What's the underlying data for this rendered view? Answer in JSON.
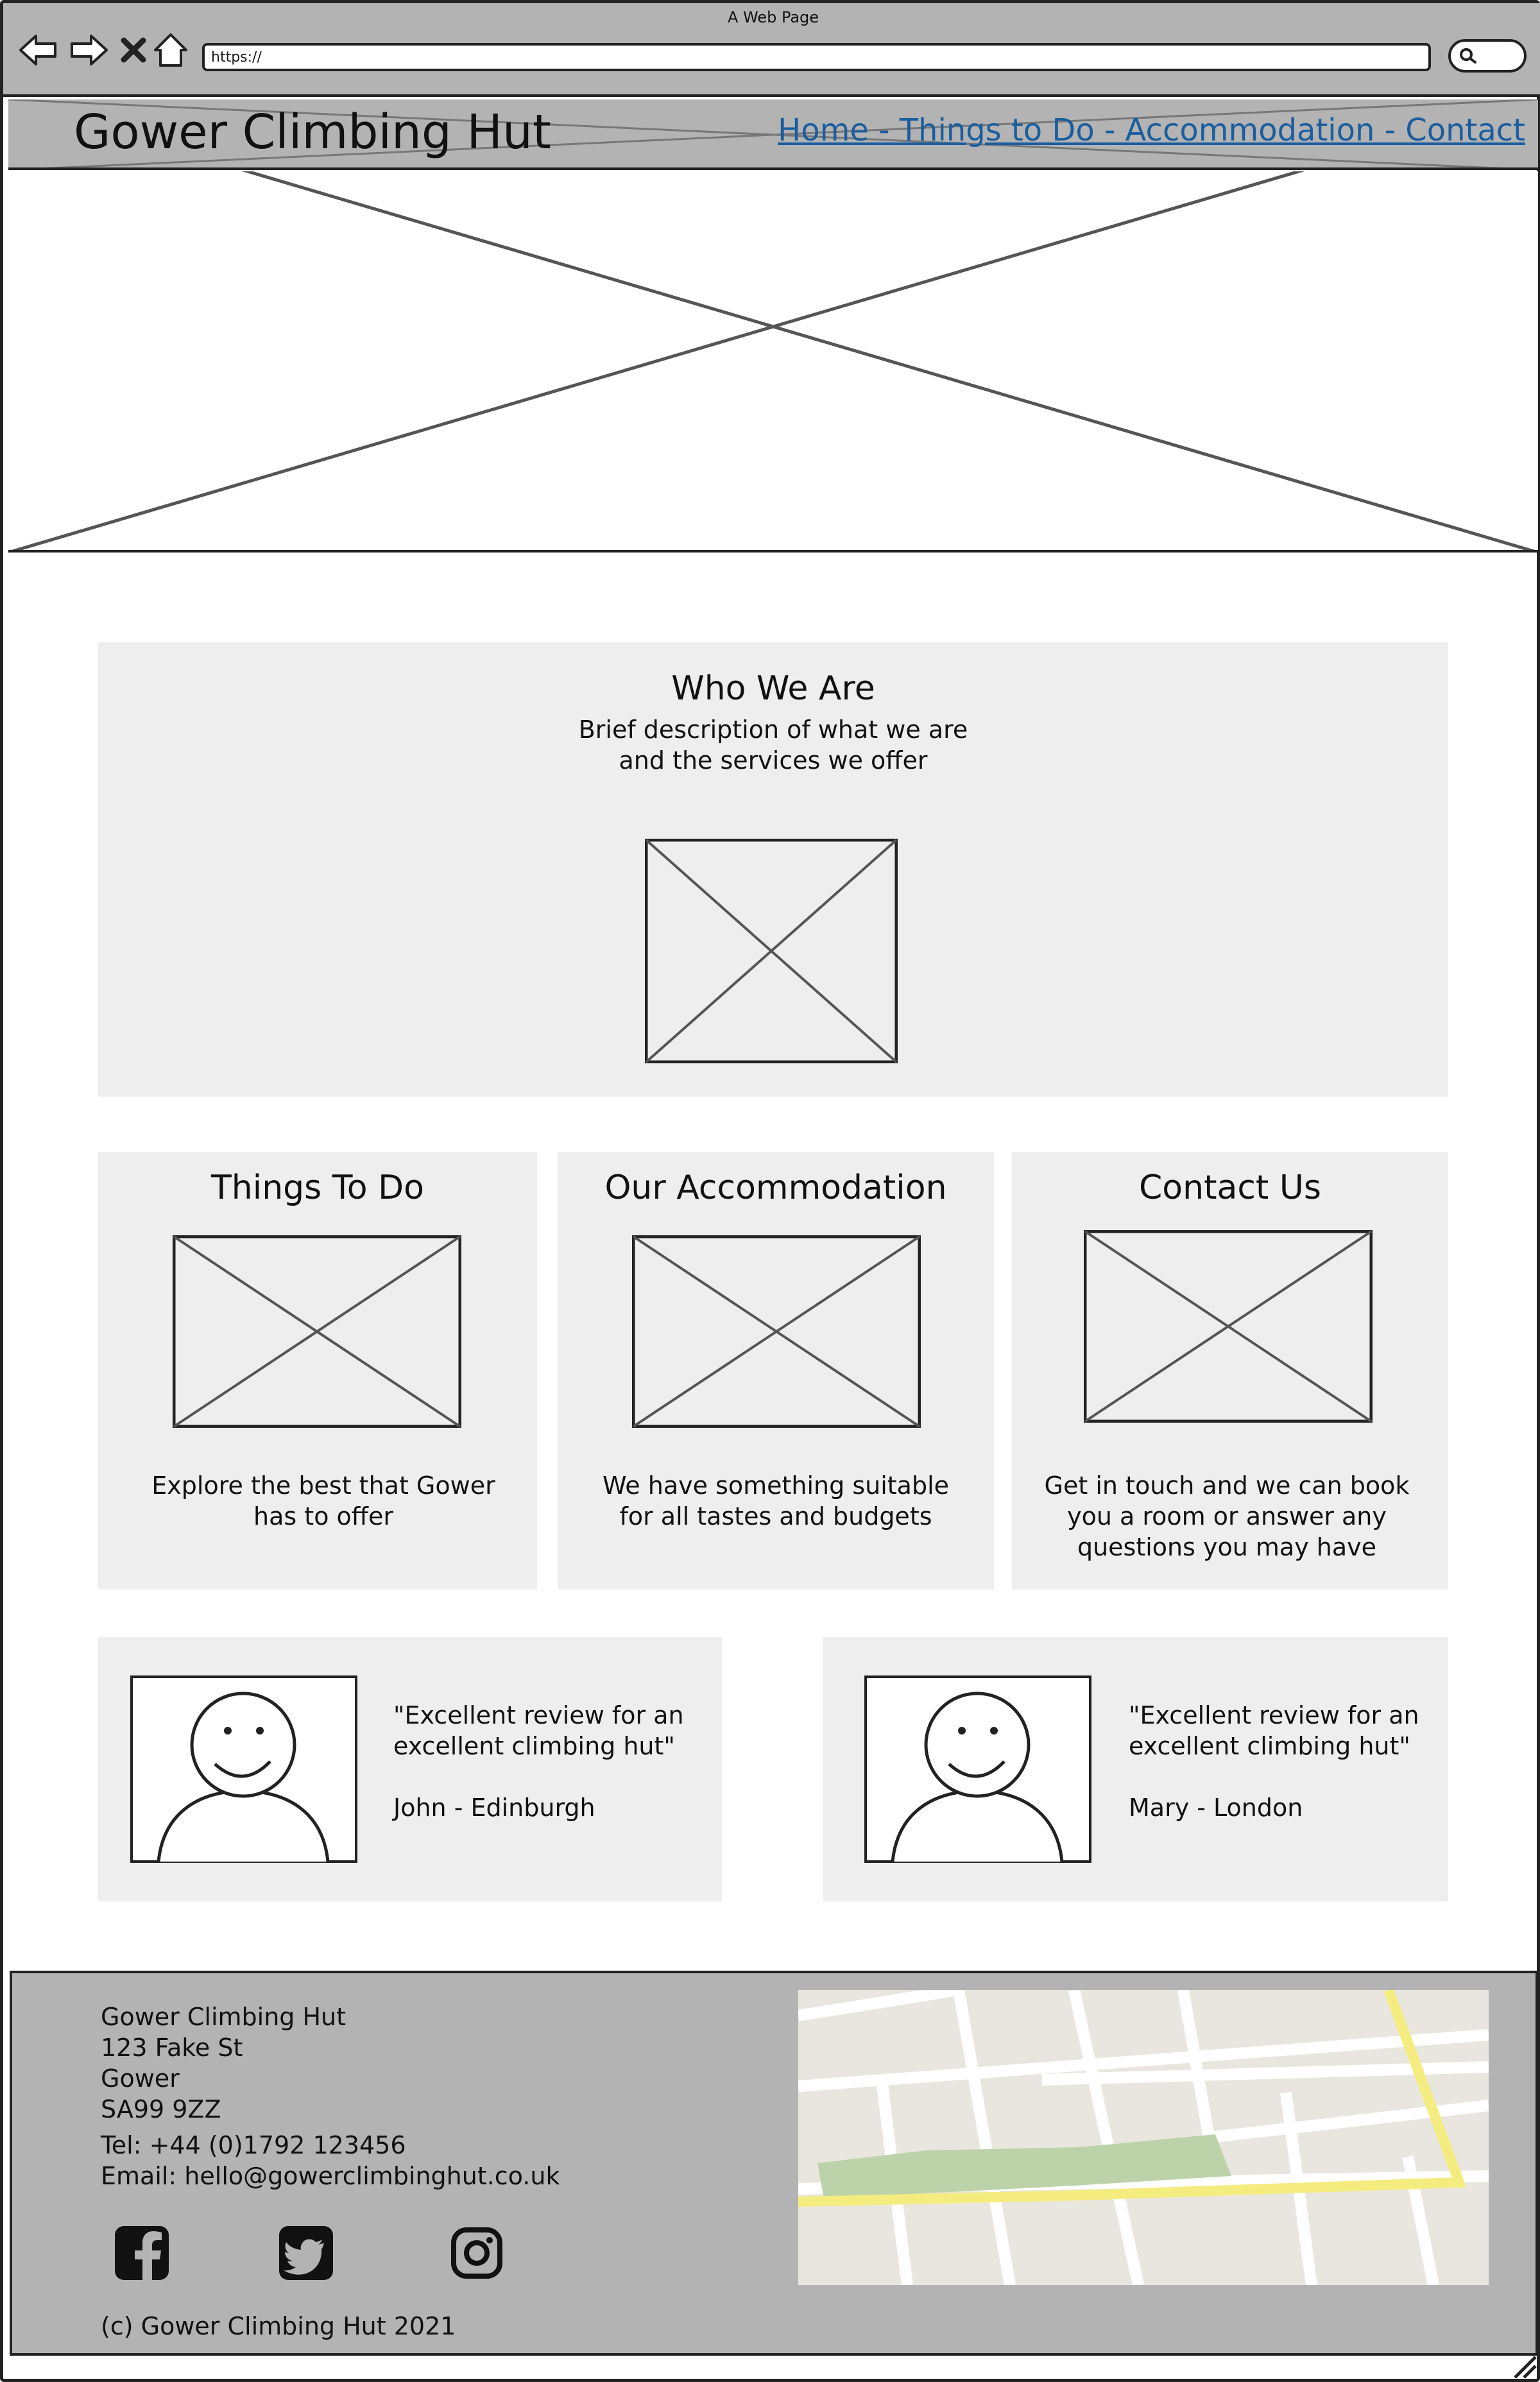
{
  "browser": {
    "window_title": "A Web Page",
    "url": "https://"
  },
  "site": {
    "title": "Gower Climbing Hut",
    "nav": "Home - Things to Do - Accommodation - Contact"
  },
  "about": {
    "title": "Who We Are",
    "text_line1": "Brief description of what we are",
    "text_line2": "and the services we offer"
  },
  "cards": [
    {
      "title": "Things To Do",
      "text_line1": "Explore the best that Gower",
      "text_line2": "has to offer",
      "text_line3": ""
    },
    {
      "title": "Our Accommodation",
      "text_line1": "We have something suitable",
      "text_line2": "for all tastes and budgets",
      "text_line3": ""
    },
    {
      "title": "Contact Us",
      "text_line1": "Get in touch and we can book",
      "text_line2": "you a room or answer any",
      "text_line3": "questions you may have"
    }
  ],
  "reviews": [
    {
      "quote_line1": "\"Excellent review for an",
      "quote_line2": "excellent climbing hut\"",
      "author": "John - Edinburgh"
    },
    {
      "quote_line1": "\"Excellent review for an",
      "quote_line2": "excellent climbing hut\"",
      "author": "Mary - London"
    }
  ],
  "footer": {
    "address": [
      "Gower Climbing Hut",
      "123 Fake St",
      "Gower",
      "SA99 9ZZ"
    ],
    "tel": "Tel: +44 (0)1792 123456",
    "email": "Email: hello@gowerclimbinghut.co.uk",
    "social_icons": [
      "facebook-icon",
      "twitter-icon",
      "instagram-icon"
    ],
    "copyright": "(c) Gower Climbing Hut 2021"
  },
  "colors": {
    "chrome_gray": "#b3b3b3",
    "panel_gray": "#eeeeee",
    "link_blue": "#1a5ea0",
    "map_park": "#bcd3a9",
    "map_road_yellow": "#f4ec7e"
  }
}
